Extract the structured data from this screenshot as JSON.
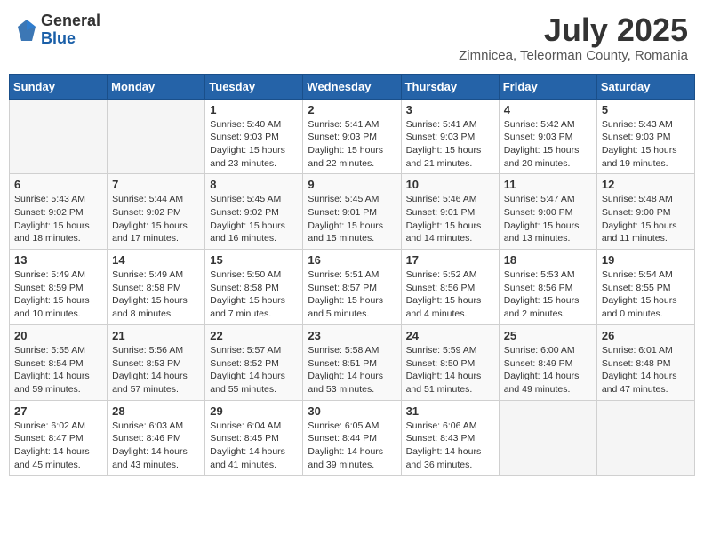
{
  "logo": {
    "general": "General",
    "blue": "Blue"
  },
  "header": {
    "month": "July 2025",
    "location": "Zimnicea, Teleorman County, Romania"
  },
  "weekdays": [
    "Sunday",
    "Monday",
    "Tuesday",
    "Wednesday",
    "Thursday",
    "Friday",
    "Saturday"
  ],
  "weeks": [
    [
      {
        "day": "",
        "info": ""
      },
      {
        "day": "",
        "info": ""
      },
      {
        "day": "1",
        "sunrise": "Sunrise: 5:40 AM",
        "sunset": "Sunset: 9:03 PM",
        "daylight": "Daylight: 15 hours and 23 minutes."
      },
      {
        "day": "2",
        "sunrise": "Sunrise: 5:41 AM",
        "sunset": "Sunset: 9:03 PM",
        "daylight": "Daylight: 15 hours and 22 minutes."
      },
      {
        "day": "3",
        "sunrise": "Sunrise: 5:41 AM",
        "sunset": "Sunset: 9:03 PM",
        "daylight": "Daylight: 15 hours and 21 minutes."
      },
      {
        "day": "4",
        "sunrise": "Sunrise: 5:42 AM",
        "sunset": "Sunset: 9:03 PM",
        "daylight": "Daylight: 15 hours and 20 minutes."
      },
      {
        "day": "5",
        "sunrise": "Sunrise: 5:43 AM",
        "sunset": "Sunset: 9:03 PM",
        "daylight": "Daylight: 15 hours and 19 minutes."
      }
    ],
    [
      {
        "day": "6",
        "sunrise": "Sunrise: 5:43 AM",
        "sunset": "Sunset: 9:02 PM",
        "daylight": "Daylight: 15 hours and 18 minutes."
      },
      {
        "day": "7",
        "sunrise": "Sunrise: 5:44 AM",
        "sunset": "Sunset: 9:02 PM",
        "daylight": "Daylight: 15 hours and 17 minutes."
      },
      {
        "day": "8",
        "sunrise": "Sunrise: 5:45 AM",
        "sunset": "Sunset: 9:02 PM",
        "daylight": "Daylight: 15 hours and 16 minutes."
      },
      {
        "day": "9",
        "sunrise": "Sunrise: 5:45 AM",
        "sunset": "Sunset: 9:01 PM",
        "daylight": "Daylight: 15 hours and 15 minutes."
      },
      {
        "day": "10",
        "sunrise": "Sunrise: 5:46 AM",
        "sunset": "Sunset: 9:01 PM",
        "daylight": "Daylight: 15 hours and 14 minutes."
      },
      {
        "day": "11",
        "sunrise": "Sunrise: 5:47 AM",
        "sunset": "Sunset: 9:00 PM",
        "daylight": "Daylight: 15 hours and 13 minutes."
      },
      {
        "day": "12",
        "sunrise": "Sunrise: 5:48 AM",
        "sunset": "Sunset: 9:00 PM",
        "daylight": "Daylight: 15 hours and 11 minutes."
      }
    ],
    [
      {
        "day": "13",
        "sunrise": "Sunrise: 5:49 AM",
        "sunset": "Sunset: 8:59 PM",
        "daylight": "Daylight: 15 hours and 10 minutes."
      },
      {
        "day": "14",
        "sunrise": "Sunrise: 5:49 AM",
        "sunset": "Sunset: 8:58 PM",
        "daylight": "Daylight: 15 hours and 8 minutes."
      },
      {
        "day": "15",
        "sunrise": "Sunrise: 5:50 AM",
        "sunset": "Sunset: 8:58 PM",
        "daylight": "Daylight: 15 hours and 7 minutes."
      },
      {
        "day": "16",
        "sunrise": "Sunrise: 5:51 AM",
        "sunset": "Sunset: 8:57 PM",
        "daylight": "Daylight: 15 hours and 5 minutes."
      },
      {
        "day": "17",
        "sunrise": "Sunrise: 5:52 AM",
        "sunset": "Sunset: 8:56 PM",
        "daylight": "Daylight: 15 hours and 4 minutes."
      },
      {
        "day": "18",
        "sunrise": "Sunrise: 5:53 AM",
        "sunset": "Sunset: 8:56 PM",
        "daylight": "Daylight: 15 hours and 2 minutes."
      },
      {
        "day": "19",
        "sunrise": "Sunrise: 5:54 AM",
        "sunset": "Sunset: 8:55 PM",
        "daylight": "Daylight: 15 hours and 0 minutes."
      }
    ],
    [
      {
        "day": "20",
        "sunrise": "Sunrise: 5:55 AM",
        "sunset": "Sunset: 8:54 PM",
        "daylight": "Daylight: 14 hours and 59 minutes."
      },
      {
        "day": "21",
        "sunrise": "Sunrise: 5:56 AM",
        "sunset": "Sunset: 8:53 PM",
        "daylight": "Daylight: 14 hours and 57 minutes."
      },
      {
        "day": "22",
        "sunrise": "Sunrise: 5:57 AM",
        "sunset": "Sunset: 8:52 PM",
        "daylight": "Daylight: 14 hours and 55 minutes."
      },
      {
        "day": "23",
        "sunrise": "Sunrise: 5:58 AM",
        "sunset": "Sunset: 8:51 PM",
        "daylight": "Daylight: 14 hours and 53 minutes."
      },
      {
        "day": "24",
        "sunrise": "Sunrise: 5:59 AM",
        "sunset": "Sunset: 8:50 PM",
        "daylight": "Daylight: 14 hours and 51 minutes."
      },
      {
        "day": "25",
        "sunrise": "Sunrise: 6:00 AM",
        "sunset": "Sunset: 8:49 PM",
        "daylight": "Daylight: 14 hours and 49 minutes."
      },
      {
        "day": "26",
        "sunrise": "Sunrise: 6:01 AM",
        "sunset": "Sunset: 8:48 PM",
        "daylight": "Daylight: 14 hours and 47 minutes."
      }
    ],
    [
      {
        "day": "27",
        "sunrise": "Sunrise: 6:02 AM",
        "sunset": "Sunset: 8:47 PM",
        "daylight": "Daylight: 14 hours and 45 minutes."
      },
      {
        "day": "28",
        "sunrise": "Sunrise: 6:03 AM",
        "sunset": "Sunset: 8:46 PM",
        "daylight": "Daylight: 14 hours and 43 minutes."
      },
      {
        "day": "29",
        "sunrise": "Sunrise: 6:04 AM",
        "sunset": "Sunset: 8:45 PM",
        "daylight": "Daylight: 14 hours and 41 minutes."
      },
      {
        "day": "30",
        "sunrise": "Sunrise: 6:05 AM",
        "sunset": "Sunset: 8:44 PM",
        "daylight": "Daylight: 14 hours and 39 minutes."
      },
      {
        "day": "31",
        "sunrise": "Sunrise: 6:06 AM",
        "sunset": "Sunset: 8:43 PM",
        "daylight": "Daylight: 14 hours and 36 minutes."
      },
      {
        "day": "",
        "info": ""
      },
      {
        "day": "",
        "info": ""
      }
    ]
  ]
}
